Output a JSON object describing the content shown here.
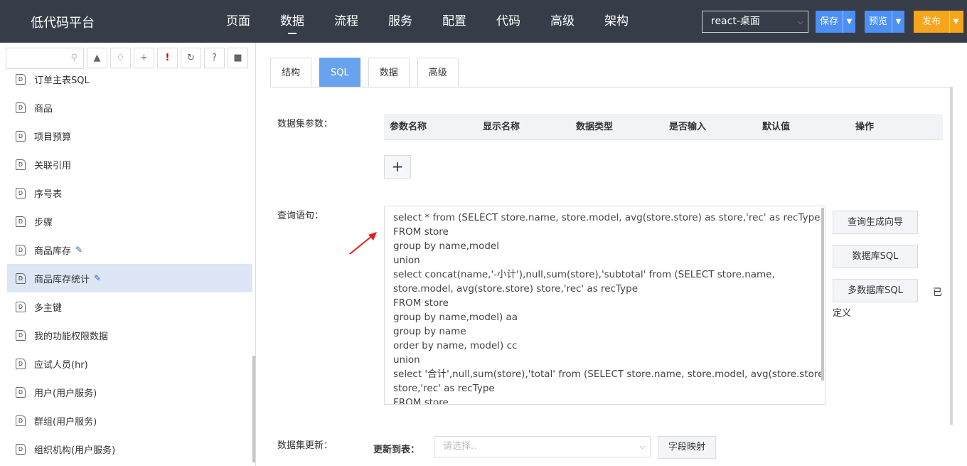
{
  "app": {
    "title": "低代码平台"
  },
  "menu": [
    "页面",
    "数据",
    "流程",
    "服务",
    "配置",
    "代码",
    "高级",
    "架构"
  ],
  "menu_active": "数据",
  "env_select": {
    "value": "react-桌面"
  },
  "buttons": {
    "save": "保存",
    "preview": "预览",
    "publish": "发布"
  },
  "colors": {
    "topbar": "#363d48",
    "accent": "#4c8ff5",
    "publish": "#f7a51b",
    "tab_active": "#69a3ef",
    "selected_row": "#dde6f5"
  },
  "sidebar": {
    "search_placeholder": "",
    "tool_icons": [
      "tree-icon",
      "tag-icon",
      "plus-icon",
      "exclamation-icon",
      "refresh-icon",
      "help-icon",
      "comment-icon"
    ],
    "items": [
      {
        "label": "订单主表SQL",
        "icon": "D",
        "edit": false
      },
      {
        "label": "商品",
        "icon": "D",
        "edit": false
      },
      {
        "label": "项目预算",
        "icon": "D",
        "edit": false
      },
      {
        "label": "关联引用",
        "icon": "D",
        "edit": false
      },
      {
        "label": "序号表",
        "icon": "D",
        "edit": false
      },
      {
        "label": "步骤",
        "icon": "D",
        "edit": false
      },
      {
        "label": "商品库存",
        "icon": "D",
        "edit": true
      },
      {
        "label": "商品库存统计",
        "icon": "D",
        "edit": true,
        "selected": true
      },
      {
        "label": "多主键",
        "icon": "D",
        "edit": false
      },
      {
        "label": "我的功能权限数据",
        "icon": "D",
        "edit": false
      },
      {
        "label": "应试人员(hr)",
        "icon": "D",
        "edit": false
      },
      {
        "label": "用户(用户服务)",
        "icon": "D",
        "edit": false
      },
      {
        "label": "群组(用户服务)",
        "icon": "D",
        "edit": false
      },
      {
        "label": "组织机构(用户服务)",
        "icon": "D",
        "edit": false
      }
    ]
  },
  "tabs": [
    "结构",
    "SQL",
    "数据",
    "高级"
  ],
  "tab_active": "SQL",
  "params": {
    "label": "数据集参数：",
    "columns": [
      "参数名称",
      "显示名称",
      "数据类型",
      "是否输入",
      "默认值",
      "操作"
    ],
    "add_label": "+"
  },
  "query": {
    "label": "查询语句：",
    "sql_lines": [
      "select * from (SELECT store.name, store.model, avg(store.store) as store,'rec' as recType",
      "FROM store",
      "group by name,model",
      "union",
      "select concat(name,'-小计'),null,sum(store),'subtotal' from (SELECT store.name,",
      "store.model, avg(store.store) store,'rec' as recType",
      "FROM store",
      "group by name,model) aa",
      "group by name",
      "order by name, model) cc",
      "union",
      "select '合计',null,sum(store),'total' from (SELECT store.name, store.model, avg(store.store)",
      "store,'rec' as recType",
      "FROM store"
    ],
    "buttons": [
      "查询生成向导",
      "数据库SQL",
      "多数据库SQL"
    ],
    "defined_text_a": "已",
    "defined_text_b": "定义"
  },
  "update": {
    "label": "数据集更新：",
    "table_label": "更新到表：",
    "select_placeholder": "请选择..",
    "map_button": "字段映射"
  }
}
